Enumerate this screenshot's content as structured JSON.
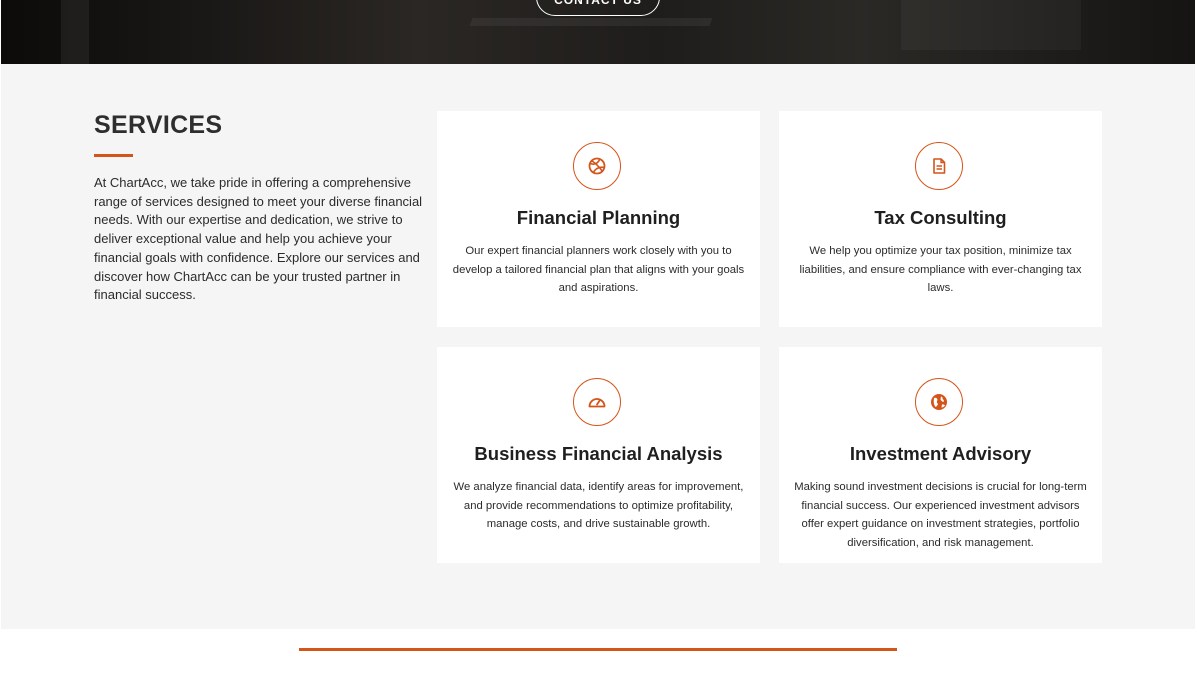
{
  "hero": {
    "contact_label": "CONTACT US"
  },
  "services": {
    "title": "SERVICES",
    "intro": "At ChartAcc, we take pride in offering a comprehensive range of services designed to meet your diverse financial needs. With our expertise and dedication, we strive to deliver exceptional value and help you achieve your financial goals with confidence. Explore our services and discover how ChartAcc can be your trusted partner in financial success.",
    "accent_color": "#d4551a",
    "cards": [
      {
        "icon": "basketball-icon",
        "title": "Financial Planning",
        "text": "Our expert financial planners work closely with you to develop a tailored financial plan that aligns with your goals and aspirations."
      },
      {
        "icon": "document-icon",
        "title": "Tax Consulting",
        "text": "We help you optimize your tax position, minimize tax liabilities, and ensure compliance with ever-changing tax laws."
      },
      {
        "icon": "gauge-icon",
        "title": "Business Financial Analysis",
        "text": "We analyze financial data, identify areas for improvement, and provide recommendations to optimize profitability, manage costs, and drive sustainable growth."
      },
      {
        "icon": "globe-icon",
        "title": "Investment Advisory",
        "text": "Making sound investment decisions is crucial for long-term financial success. Our experienced investment advisors offer expert guidance on investment strategies, portfolio diversification, and risk management."
      }
    ]
  }
}
